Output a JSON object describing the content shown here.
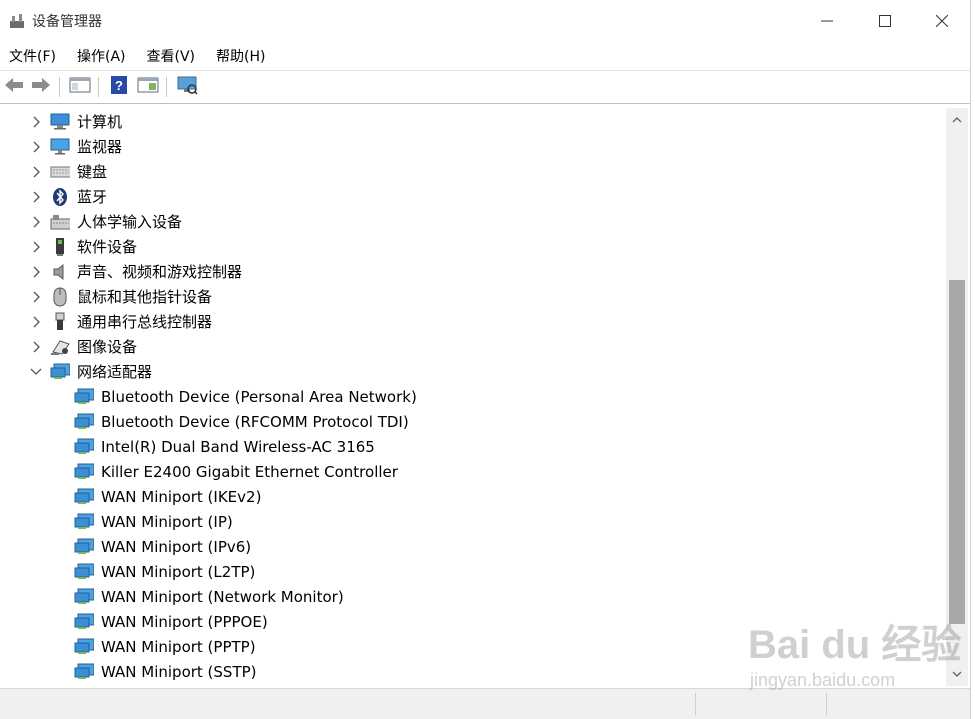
{
  "window": {
    "title": "设备管理器",
    "minimize_glyph": "—",
    "maximize_glyph": "☐",
    "close_glyph": "✕"
  },
  "menu": [
    {
      "label": "文件(F)"
    },
    {
      "label": "操作(A)"
    },
    {
      "label": "查看(V)"
    },
    {
      "label": "帮助(H)"
    }
  ],
  "toolbar": {
    "buttons": [
      {
        "icon": "back-arrow-icon"
      },
      {
        "icon": "forward-arrow-icon"
      },
      {
        "icon": "properties-icon"
      },
      {
        "icon": "help-icon"
      },
      {
        "icon": "update-driver-icon"
      },
      {
        "icon": "scan-hardware-icon"
      }
    ]
  },
  "tree": {
    "categories": [
      {
        "label": "计算机",
        "icon": "computer-icon",
        "expanded": false
      },
      {
        "label": "监视器",
        "icon": "monitor-icon",
        "expanded": false
      },
      {
        "label": "键盘",
        "icon": "keyboard-icon",
        "expanded": false
      },
      {
        "label": "蓝牙",
        "icon": "bluetooth-icon",
        "expanded": false
      },
      {
        "label": "人体学输入设备",
        "icon": "hid-icon",
        "expanded": false
      },
      {
        "label": "软件设备",
        "icon": "software-device-icon",
        "expanded": false
      },
      {
        "label": "声音、视频和游戏控制器",
        "icon": "speaker-icon",
        "expanded": false
      },
      {
        "label": "鼠标和其他指针设备",
        "icon": "mouse-icon",
        "expanded": false
      },
      {
        "label": "通用串行总线控制器",
        "icon": "usb-icon",
        "expanded": false
      },
      {
        "label": "图像设备",
        "icon": "camera-icon",
        "expanded": false
      },
      {
        "label": "网络适配器",
        "icon": "network-adapter-icon",
        "expanded": true
      }
    ],
    "network_adapters": [
      "Bluetooth Device (Personal Area Network)",
      "Bluetooth Device (RFCOMM Protocol TDI)",
      "Intel(R) Dual Band Wireless-AC 3165",
      "Killer E2400 Gigabit Ethernet Controller",
      "WAN Miniport (IKEv2)",
      "WAN Miniport (IP)",
      "WAN Miniport (IPv6)",
      "WAN Miniport (L2TP)",
      "WAN Miniport (Network Monitor)",
      "WAN Miniport (PPPOE)",
      "WAN Miniport (PPTP)",
      "WAN Miniport (SSTP)"
    ]
  },
  "watermark": {
    "main": "Bai du 经验",
    "sub": "jingyan.baidu.com"
  },
  "colors": {
    "accent_blue": "#1e90d6",
    "scroll_thumb": "#a8a8a8"
  }
}
